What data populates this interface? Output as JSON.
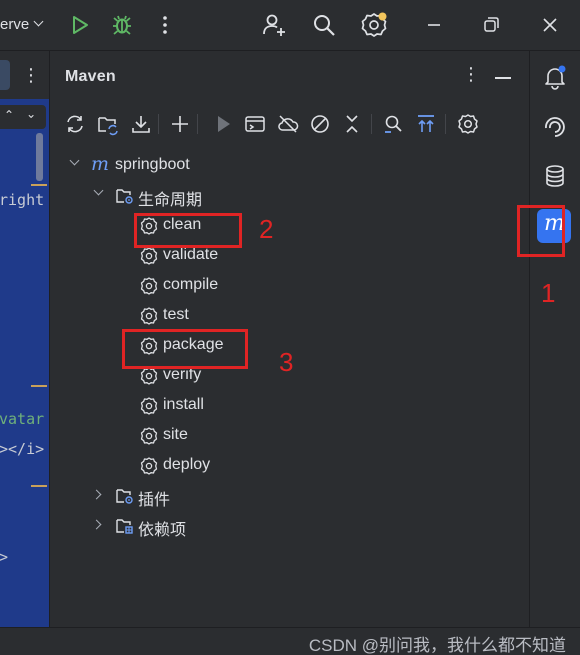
{
  "titlebar": {
    "run_config": "erve",
    "icons": [
      "run-icon",
      "debug-icon",
      "more-icon",
      "add-user-icon",
      "search-icon",
      "settings-icon",
      "minimize-icon",
      "restore-icon",
      "close-icon"
    ]
  },
  "editor": {
    "code_lines": [
      {
        "text": "right",
        "color": "#c7cbd4"
      },
      {
        "text": "vatar",
        "color": "#6fb07a"
      },
      {
        "text": "></i>",
        "color": "#c7cbd4"
      },
      {
        "text": ">",
        "color": "#c7cbd4"
      }
    ]
  },
  "maven": {
    "title": "Maven",
    "toolbar_icons": [
      "reload-icon",
      "reload-project-icon",
      "download-icon",
      "add-icon",
      "run-icon",
      "execute-goal-icon",
      "offline-icon",
      "skip-tests-icon",
      "collapse-icon",
      "analyze-dependencies-icon",
      "expand-all-icon",
      "settings-icon"
    ],
    "project": "springboot",
    "lifecycle_label": "生命周期",
    "lifecycle": [
      "clean",
      "validate",
      "compile",
      "test",
      "package",
      "verify",
      "install",
      "site",
      "deploy"
    ],
    "plugins_label": "插件",
    "dependencies_label": "依赖项"
  },
  "annotations": {
    "step1": "1",
    "step2": "2",
    "step3": "3",
    "color": "#e02424"
  },
  "rail": {
    "icons": [
      "notifications-icon",
      "ai-assistant-icon",
      "database-icon",
      "maven-icon"
    ],
    "maven_letter": "m"
  },
  "status": {
    "watermark": "CSDN @别问我，我什么都不知道"
  },
  "colors": {
    "bg": "#2b2d30",
    "accent": "#3574f0",
    "editor_bg": "#1f3a8a",
    "run_green": "#5fb865",
    "badge": "#f2c55c"
  }
}
